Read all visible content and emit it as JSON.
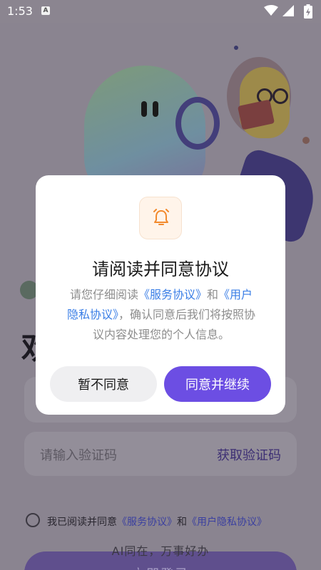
{
  "status_bar": {
    "time": "1:53",
    "notif_letter": "A"
  },
  "background": {
    "greeting_partial": "欢",
    "code_placeholder": "请输入验证码",
    "get_code_label": "获取验证码",
    "agree_prefix": "我已阅读并同意",
    "agree_link_service": "《服务协议》",
    "agree_and": "和",
    "agree_link_privacy": "《用户隐私协议》",
    "slogan": "AI同在，万事好办",
    "login_label": "立即登录"
  },
  "dialog": {
    "title": "请阅读并同意协议",
    "body_prefix": "请您仔细阅读",
    "link_service": "《服务协议》",
    "body_and": "和",
    "link_privacy": "《用户隐私协议》",
    "body_suffix": "，确认同意后我们将按照协议内容处理您的个人信息。",
    "decline_label": "暂不同意",
    "accept_label": "同意并继续"
  },
  "colors": {
    "accent": "#6c4ee3",
    "link": "#3a7ee6",
    "bell": "#f28a2e"
  }
}
